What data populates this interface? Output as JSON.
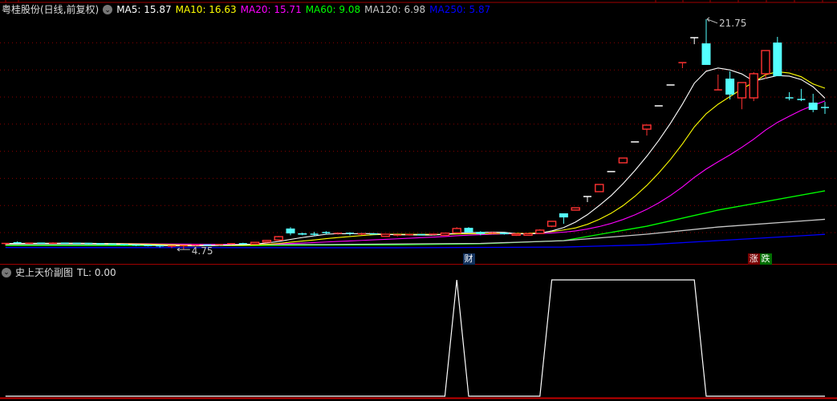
{
  "header": {
    "title": "粤桂股份(日线,前复权)",
    "ma_legend": [
      {
        "label": "MA5: 15.87",
        "color": "#ffffff"
      },
      {
        "label": "MA10: 16.63",
        "color": "#ffff00"
      },
      {
        "label": "MA20: 15.71",
        "color": "#ff00ff"
      },
      {
        "label": "MA60: 9.08",
        "color": "#00ff00"
      },
      {
        "label": "MA120: 6.98",
        "color": "#c8c8c8"
      },
      {
        "label": "MA250: 5.87",
        "color": "#0000ff"
      }
    ]
  },
  "subchart": {
    "title": "史上天价副图",
    "value_label": "TL: 0.00"
  },
  "markers": {
    "finance": "财",
    "rise": "涨",
    "fall": "跌"
  },
  "chart_data": {
    "type": "candlestick",
    "title": "粤桂股份(日线,前复权)",
    "price_gridlines": [
      6,
      8,
      10,
      12,
      14,
      16,
      18,
      20
    ],
    "ylim": [
      4.75,
      21.75
    ],
    "annotations": [
      {
        "label": "21.75",
        "index": 59,
        "price": 21.75
      },
      {
        "label": "4.75",
        "index": 15,
        "price": 4.75
      }
    ],
    "candle_format": [
      "open",
      "high",
      "low",
      "close",
      "color"
    ],
    "candles": [
      [
        5.15,
        5.2,
        5.05,
        5.2,
        "r"
      ],
      [
        5.25,
        5.35,
        5.2,
        5.2,
        "c"
      ],
      [
        5.2,
        5.25,
        5.15,
        5.22,
        "r"
      ],
      [
        5.22,
        5.25,
        5.18,
        5.2,
        "c"
      ],
      [
        5.2,
        5.28,
        5.17,
        5.22,
        "r"
      ],
      [
        5.22,
        5.25,
        5.2,
        5.21,
        "c"
      ],
      [
        5.21,
        5.24,
        5.19,
        5.2,
        "c"
      ],
      [
        5.2,
        5.23,
        5.15,
        5.18,
        "c"
      ],
      [
        5.18,
        5.2,
        5.12,
        5.15,
        "c"
      ],
      [
        5.15,
        5.18,
        5.1,
        5.12,
        "c"
      ],
      [
        5.12,
        5.15,
        5.05,
        5.08,
        "c"
      ],
      [
        5.08,
        5.12,
        5.0,
        5.05,
        "c"
      ],
      [
        5.05,
        5.1,
        4.98,
        5.02,
        "c"
      ],
      [
        5.02,
        5.06,
        4.9,
        4.98,
        "c"
      ],
      [
        4.98,
        5.02,
        4.85,
        5.0,
        "r"
      ],
      [
        4.98,
        5.05,
        4.75,
        5.03,
        "r"
      ],
      [
        5.03,
        5.1,
        5.0,
        5.08,
        "r"
      ],
      [
        5.08,
        5.12,
        5.02,
        5.05,
        "c"
      ],
      [
        5.05,
        5.15,
        5.03,
        5.12,
        "r"
      ],
      [
        5.12,
        5.2,
        5.1,
        5.18,
        "r"
      ],
      [
        5.18,
        5.25,
        5.12,
        5.15,
        "c"
      ],
      [
        5.15,
        5.3,
        5.13,
        5.28,
        "r"
      ],
      [
        5.3,
        5.45,
        5.25,
        5.42,
        "r"
      ],
      [
        5.45,
        5.75,
        5.4,
        5.7,
        "r"
      ],
      [
        6.3,
        6.4,
        5.8,
        5.94,
        "c"
      ],
      [
        5.95,
        6.0,
        5.8,
        5.85,
        "c"
      ],
      [
        5.88,
        6.05,
        5.75,
        5.88,
        "c"
      ],
      [
        6.0,
        6.1,
        5.85,
        6.0,
        "c"
      ],
      [
        5.9,
        6.0,
        5.85,
        5.95,
        "r"
      ],
      [
        5.95,
        6.02,
        5.8,
        5.88,
        "c"
      ],
      [
        5.88,
        5.92,
        5.82,
        5.9,
        "r"
      ],
      [
        5.9,
        5.93,
        5.85,
        5.88,
        "c"
      ],
      [
        5.88,
        5.9,
        5.7,
        5.72,
        "r"
      ],
      [
        5.75,
        5.85,
        5.7,
        5.82,
        "r"
      ],
      [
        5.82,
        5.88,
        5.78,
        5.85,
        "r"
      ],
      [
        5.85,
        5.88,
        5.8,
        5.83,
        "c"
      ],
      [
        5.83,
        5.9,
        5.8,
        5.88,
        "r"
      ],
      [
        5.8,
        5.98,
        5.78,
        5.96,
        "r"
      ],
      [
        5.98,
        6.4,
        5.95,
        6.3,
        "r"
      ],
      [
        6.35,
        6.4,
        6.0,
        6.02,
        "c"
      ],
      [
        6.05,
        6.1,
        5.8,
        5.9,
        "c"
      ],
      [
        5.95,
        6.05,
        5.9,
        5.98,
        "r"
      ],
      [
        5.98,
        6.0,
        5.85,
        5.88,
        "c"
      ],
      [
        5.9,
        5.95,
        5.75,
        5.8,
        "r"
      ],
      [
        5.8,
        5.95,
        5.78,
        5.92,
        "r"
      ],
      [
        5.94,
        6.25,
        5.9,
        6.18,
        "r"
      ],
      [
        6.47,
        6.83,
        6.4,
        6.83,
        "r"
      ],
      [
        7.42,
        7.42,
        6.65,
        7.12,
        "c"
      ],
      [
        7.66,
        7.83,
        7.66,
        7.83,
        "r"
      ],
      [
        8.66,
        8.66,
        8.25,
        8.66,
        "w"
      ],
      [
        9.02,
        9.55,
        9.02,
        9.55,
        "r"
      ],
      [
        10.5,
        10.5,
        10.5,
        10.5,
        "w"
      ],
      [
        11.15,
        11.5,
        11.15,
        11.5,
        "r"
      ],
      [
        12.69,
        12.69,
        12.69,
        12.69,
        "w"
      ],
      [
        13.63,
        13.93,
        13.16,
        13.93,
        "r"
      ],
      [
        15.35,
        15.35,
        15.35,
        15.35,
        "w"
      ],
      [
        16.89,
        16.89,
        16.89,
        16.89,
        "w"
      ],
      [
        18.5,
        18.54,
        18.13,
        18.54,
        "r"
      ],
      [
        20.38,
        20.38,
        19.9,
        20.38,
        "w"
      ],
      [
        19.96,
        21.75,
        18.37,
        18.37,
        "c"
      ],
      [
        16.53,
        17.66,
        16.53,
        16.53,
        "r"
      ],
      [
        17.36,
        17.9,
        15.82,
        16.18,
        "c"
      ],
      [
        15.94,
        17.07,
        15.1,
        17.07,
        "r"
      ],
      [
        15.94,
        17.83,
        15.7,
        17.72,
        "r"
      ],
      [
        17.72,
        19.43,
        17.36,
        19.43,
        "r"
      ],
      [
        20.02,
        20.44,
        17.54,
        17.54,
        "c"
      ],
      [
        15.94,
        16.36,
        15.76,
        15.94,
        "c"
      ],
      [
        15.82,
        16.6,
        15.7,
        15.82,
        "c"
      ],
      [
        15.59,
        16.24,
        14.88,
        15.05,
        "c"
      ],
      [
        15.23,
        15.64,
        14.76,
        15.23,
        "c"
      ]
    ],
    "computed_ma": [
      {
        "name": "MA5",
        "period": 5,
        "color": "#ffffff"
      },
      {
        "name": "MA10",
        "period": 10,
        "color": "#ffff00"
      },
      {
        "name": "MA20",
        "period": 20,
        "color": "#ff00ff"
      }
    ],
    "long_ma": [
      {
        "name": "MA60",
        "color": "#00ff00",
        "points": [
          [
            0,
            5.05
          ],
          [
            20,
            5.05
          ],
          [
            33,
            5.1
          ],
          [
            40,
            5.17
          ],
          [
            47,
            5.41
          ],
          [
            54,
            6.47
          ],
          [
            60,
            7.66
          ],
          [
            69,
            9.08
          ]
        ]
      },
      {
        "name": "MA120",
        "color": "#c8c8c8",
        "points": [
          [
            0,
            5.12
          ],
          [
            27,
            5.12
          ],
          [
            40,
            5.2
          ],
          [
            47,
            5.4
          ],
          [
            54,
            5.88
          ],
          [
            60,
            6.41
          ],
          [
            69,
            6.98
          ]
        ]
      },
      {
        "name": "MA250",
        "color": "#0000ff",
        "points": [
          [
            0,
            4.9
          ],
          [
            33,
            4.88
          ],
          [
            47,
            4.93
          ],
          [
            54,
            5.1
          ],
          [
            60,
            5.41
          ],
          [
            69,
            5.87
          ]
        ]
      }
    ],
    "markers": [
      {
        "index": 39,
        "type": "finance"
      },
      {
        "index": 63,
        "type": "rise"
      },
      {
        "index": 64,
        "type": "fall"
      }
    ],
    "subchart": {
      "name": "TL",
      "ylim": [
        0,
        1
      ],
      "values": [
        0,
        0,
        0,
        0,
        0,
        0,
        0,
        0,
        0,
        0,
        0,
        0,
        0,
        0,
        0,
        0,
        0,
        0,
        0,
        0,
        0,
        0,
        0,
        0,
        0,
        0,
        0,
        0,
        0,
        0,
        0,
        0,
        0,
        0,
        0,
        0,
        0,
        0,
        1,
        0,
        0,
        0,
        0,
        0,
        0,
        0,
        1,
        1,
        1,
        1,
        1,
        1,
        1,
        1,
        1,
        1,
        1,
        1,
        1,
        0,
        0,
        0,
        0,
        0,
        0,
        0,
        0,
        0,
        0,
        0
      ]
    }
  }
}
